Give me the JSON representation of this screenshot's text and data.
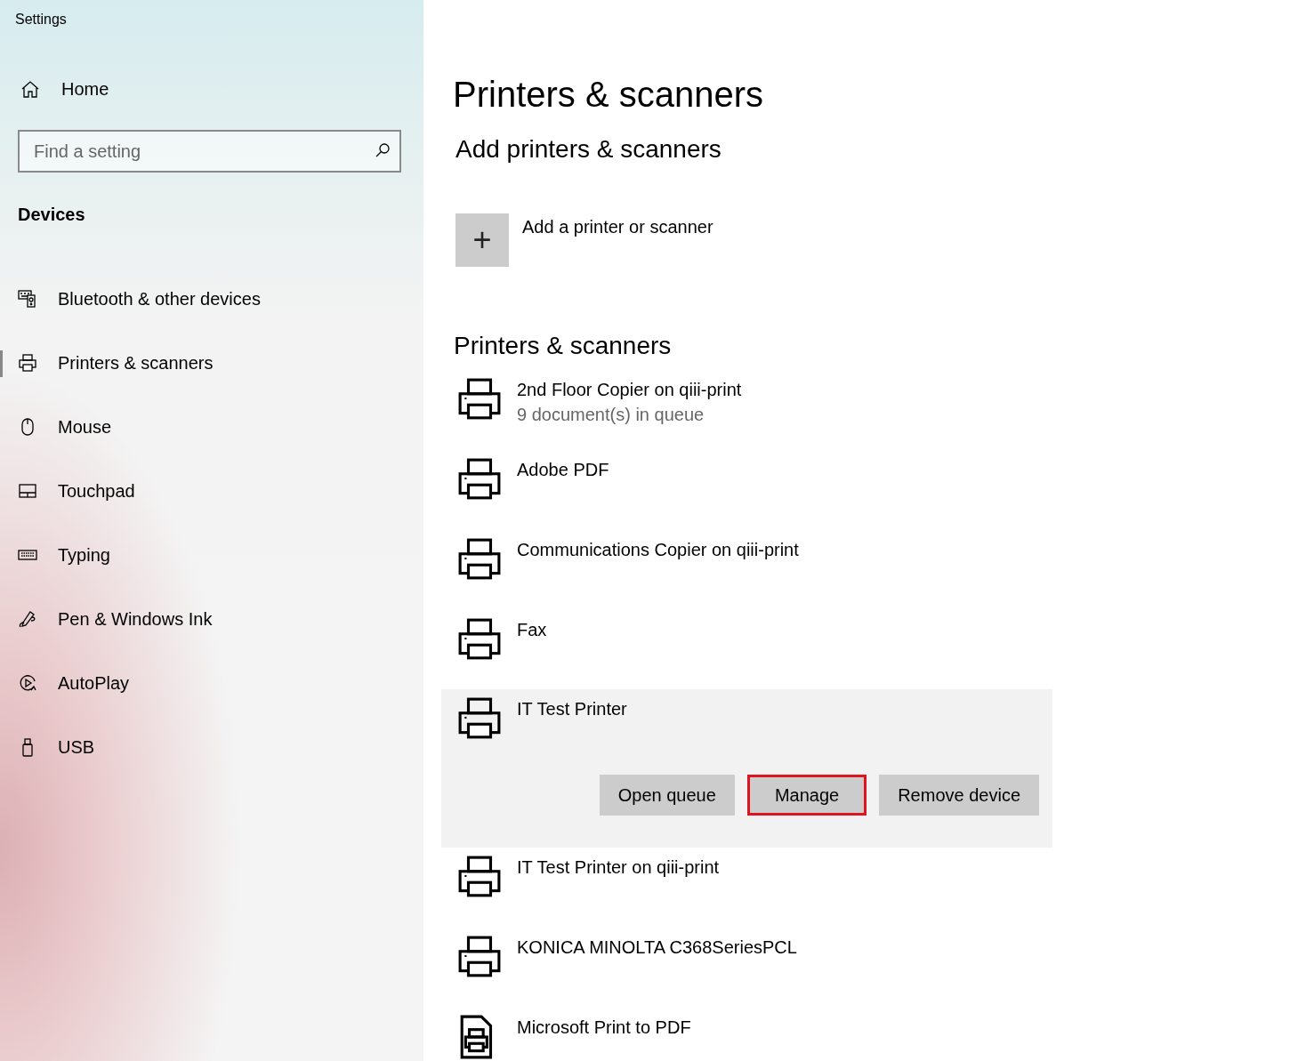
{
  "window": {
    "title": "Settings"
  },
  "sidebar": {
    "home": "Home",
    "search": {
      "placeholder": "Find a setting"
    },
    "section": "Devices",
    "items": [
      {
        "label": "Bluetooth & other devices",
        "selected": false
      },
      {
        "label": "Printers & scanners",
        "selected": true
      },
      {
        "label": "Mouse",
        "selected": false
      },
      {
        "label": "Touchpad",
        "selected": false
      },
      {
        "label": "Typing",
        "selected": false
      },
      {
        "label": "Pen & Windows Ink",
        "selected": false
      },
      {
        "label": "AutoPlay",
        "selected": false
      },
      {
        "label": "USB",
        "selected": false
      }
    ]
  },
  "main": {
    "title": "Printers & scanners",
    "add_heading": "Add printers & scanners",
    "add_label": "Add a printer or scanner",
    "add_icon": "+",
    "list_heading": "Printers & scanners",
    "devices": [
      {
        "name": "2nd Floor Copier on qiii-print",
        "status": "9 document(s) in queue",
        "kind": "printer",
        "expanded": false
      },
      {
        "name": "Adobe PDF",
        "kind": "printer",
        "expanded": false
      },
      {
        "name": "Communications Copier on qiii-print",
        "kind": "printer",
        "expanded": false
      },
      {
        "name": "Fax",
        "kind": "printer",
        "expanded": false
      },
      {
        "name": "IT Test Printer",
        "kind": "printer",
        "expanded": true,
        "buttons": [
          {
            "label": "Open queue",
            "highlighted": false
          },
          {
            "label": "Manage",
            "highlighted": true
          },
          {
            "label": "Remove device",
            "highlighted": false
          }
        ]
      },
      {
        "name": "IT Test Printer on qiii-print",
        "kind": "printer",
        "expanded": false
      },
      {
        "name": "KONICA MINOLTA C368SeriesPCL",
        "kind": "printer",
        "expanded": false
      },
      {
        "name": "Microsoft Print to PDF",
        "kind": "pdf",
        "expanded": false
      }
    ]
  }
}
